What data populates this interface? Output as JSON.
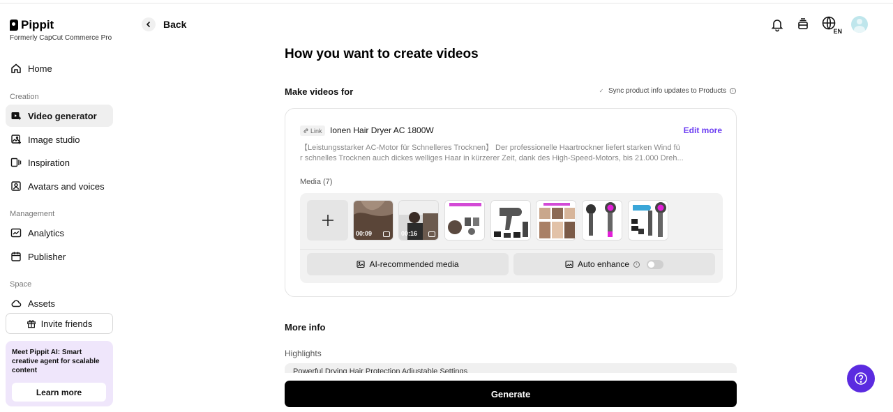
{
  "brand": {
    "name": "Pippit",
    "subtitle": "Formerly CapCut Commerce Pro"
  },
  "sidebar": {
    "home": "Home",
    "creation_label": "Creation",
    "creation_items": [
      "Video generator",
      "Image studio",
      "Inspiration",
      "Avatars and voices"
    ],
    "management_label": "Management",
    "management_items": [
      "Analytics",
      "Publisher"
    ],
    "space_label": "Space",
    "space_items": [
      "Assets"
    ],
    "invite": "Invite friends",
    "promo": {
      "text": "Meet Pippit AI: Smart creative agent for scalable content",
      "button": "Learn more"
    }
  },
  "header": {
    "back": "Back",
    "lang": "EN"
  },
  "main": {
    "title": "How you want to create videos",
    "make_videos_for": "Make videos for",
    "sync_label": "Sync product info updates to Products",
    "product": {
      "link_tag": "Link",
      "name": "Ionen Hair Dryer AC 1800W",
      "edit": "Edit more",
      "desc_line1": "【Leistungsstarker AC-Motor für Schnelleres Trocknen】 Der professionelle Haartrockner liefert starken Wind fü",
      "desc_line2": "r schnelles Trocknen auch dickes welliges Haar in kürzerer Zeit, dank des High-Speed-Motors, bis 21.000 Dreh..."
    },
    "media_label": "Media (7)",
    "media": [
      {
        "kind": "video",
        "duration": "00:09"
      },
      {
        "kind": "video",
        "duration": "00:16"
      },
      {
        "kind": "image"
      },
      {
        "kind": "image"
      },
      {
        "kind": "image"
      },
      {
        "kind": "image"
      },
      {
        "kind": "image"
      }
    ],
    "ai_media": "AI-recommended media",
    "auto_enhance": "Auto enhance",
    "more_info": "More info",
    "highlights_label": "Highlights",
    "highlights_value": "Powerful Drying Hair Protection Adjustable Settings",
    "generate": "Generate"
  },
  "colors": {
    "accent": "#6b3cf2",
    "help_bg": "#5b2be0",
    "promo_bg": "#efe6fb"
  }
}
